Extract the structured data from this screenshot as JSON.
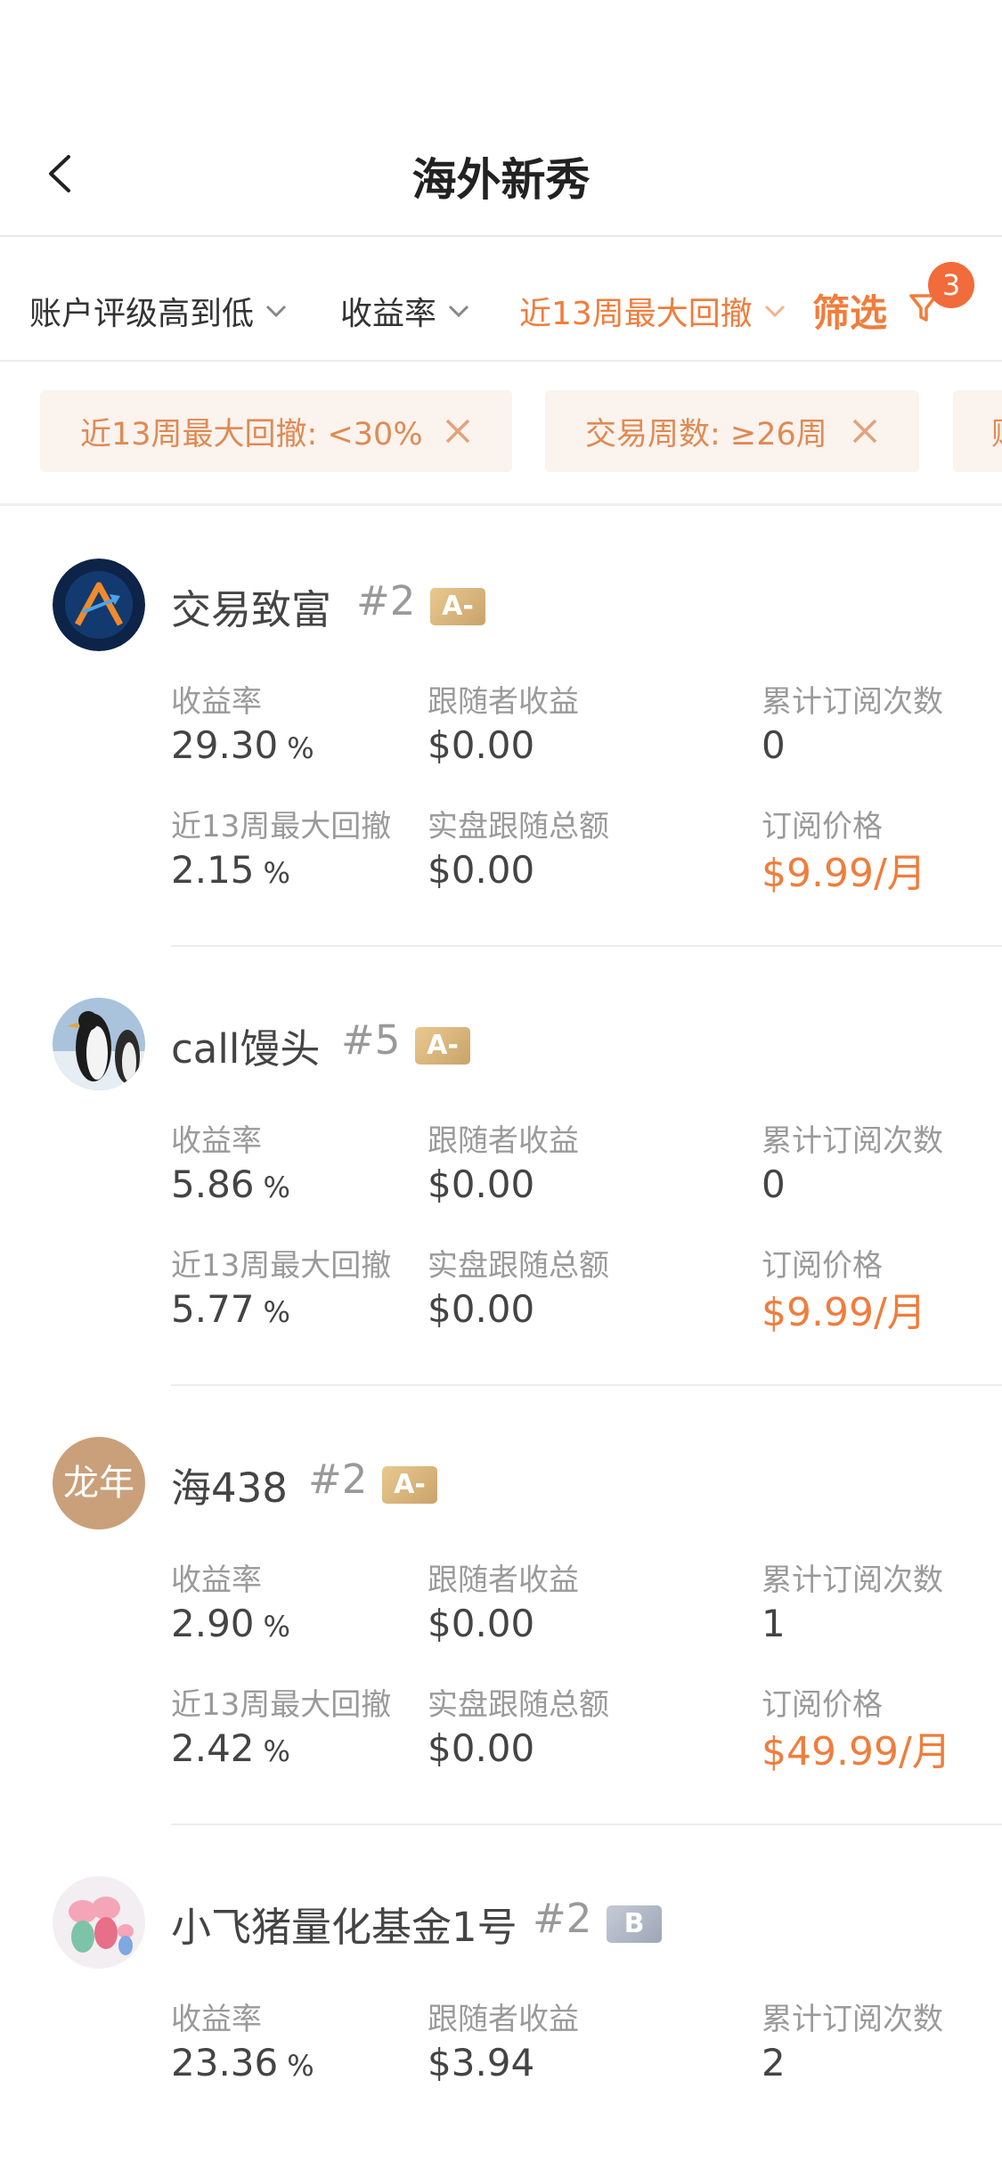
{
  "header": {
    "title": "海外新秀"
  },
  "sortbar": {
    "sort1": "账户评级高到低",
    "sort2": "收益率",
    "sort3": "近13周最大回撤",
    "filter_label": "筛选",
    "filter_count": "3"
  },
  "chips": [
    {
      "label": "近13周最大回撤: <30%"
    },
    {
      "label": "交易周数: ≥26周"
    },
    {
      "label": "账"
    }
  ],
  "labels": {
    "return": "收益率",
    "follower_profit": "跟随者收益",
    "sub_count": "累计订阅次数",
    "max_drawdown": "近13周最大回撤",
    "follow_total": "实盘跟随总额",
    "price": "订阅价格"
  },
  "accent_color": "#f07d3c",
  "traders": [
    {
      "name": "交易致富",
      "rank": "#2",
      "grade": "A-",
      "return": "29.30",
      "return_unit": "%",
      "follower_profit": "$0.00",
      "sub_count": "0",
      "drawdown": "2.15",
      "drawdown_unit": "%",
      "follow_total": "$0.00",
      "price": "$9.99/月"
    },
    {
      "name": "call馒头",
      "rank": "#5",
      "grade": "A-",
      "return": "5.86",
      "return_unit": "%",
      "follower_profit": "$0.00",
      "sub_count": "0",
      "drawdown": "5.77",
      "drawdown_unit": "%",
      "follow_total": "$0.00",
      "price": "$9.99/月"
    },
    {
      "name": "海438",
      "rank": "#2",
      "grade": "A-",
      "avatar_text": "龙年",
      "return": "2.90",
      "return_unit": "%",
      "follower_profit": "$0.00",
      "sub_count": "1",
      "drawdown": "2.42",
      "drawdown_unit": "%",
      "follow_total": "$0.00",
      "price": "$49.99/月"
    },
    {
      "name": "小飞猪量化基金1号",
      "rank": "#2",
      "grade": "B",
      "return": "23.36",
      "return_unit": "%",
      "follower_profit": "$3.94",
      "sub_count": "2"
    }
  ]
}
